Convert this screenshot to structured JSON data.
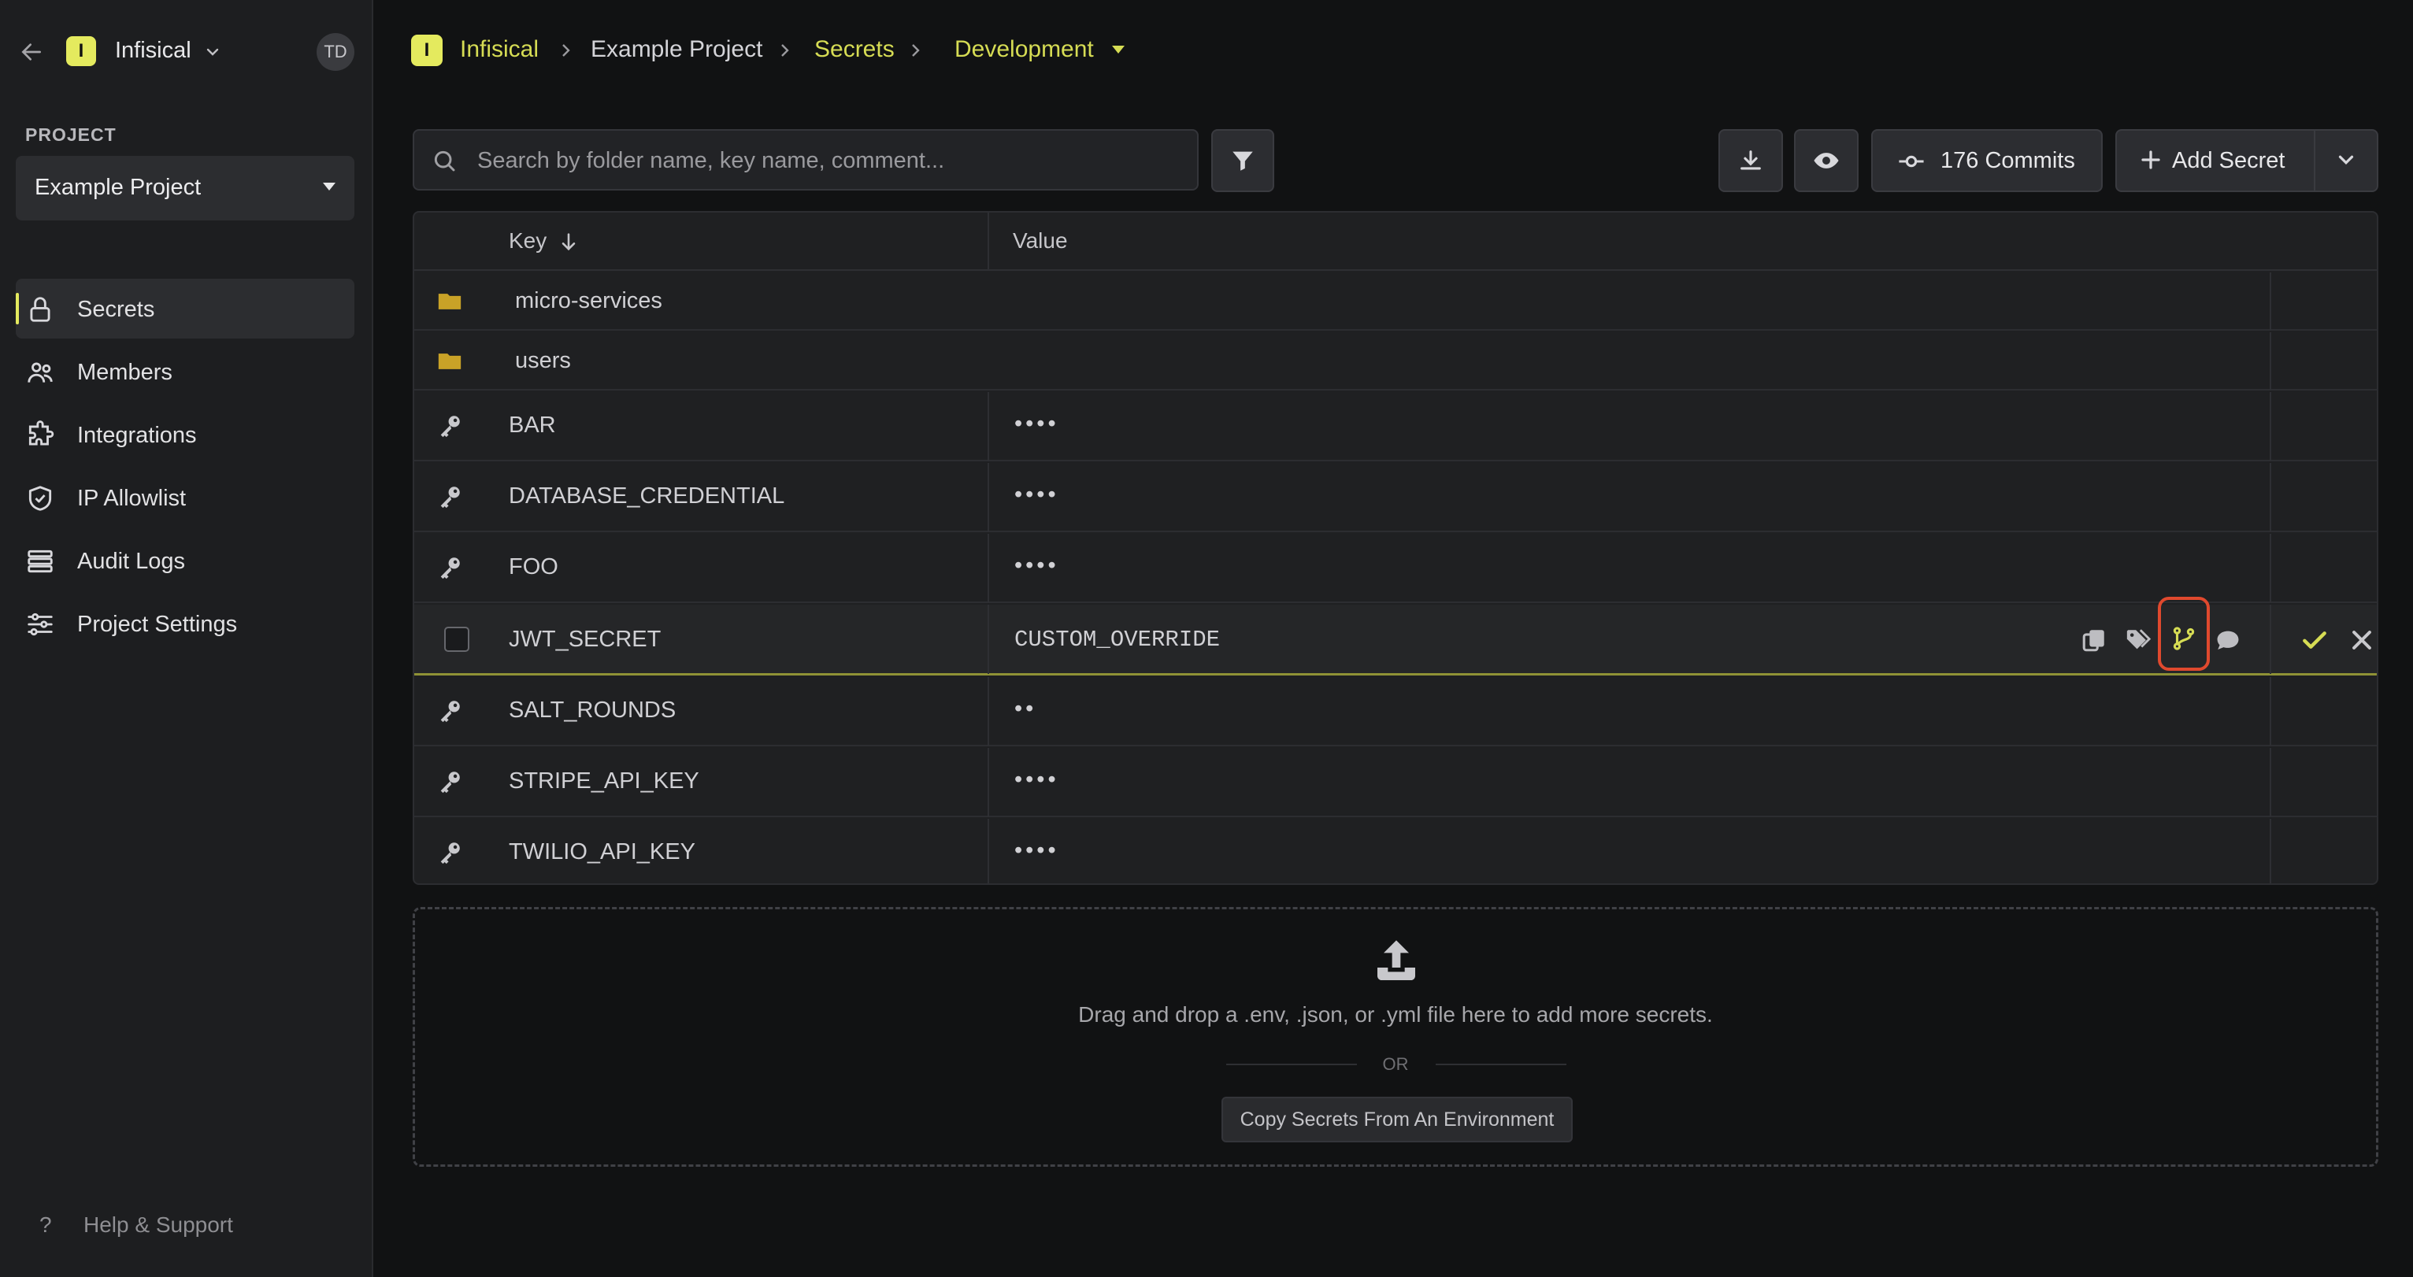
{
  "org": {
    "logo_letter": "I",
    "name": "Infisical",
    "avatar_initials": "TD"
  },
  "project": {
    "section_label": "PROJECT",
    "selected": "Example Project"
  },
  "nav": {
    "items": [
      {
        "label": "Secrets",
        "icon": "lock-icon",
        "active": true
      },
      {
        "label": "Members",
        "icon": "users-icon"
      },
      {
        "label": "Integrations",
        "icon": "puzzle-icon"
      },
      {
        "label": "IP Allowlist",
        "icon": "shield-icon"
      },
      {
        "label": "Audit Logs",
        "icon": "list-icon"
      },
      {
        "label": "Project Settings",
        "icon": "sliders-icon"
      }
    ],
    "help": "Help & Support"
  },
  "breadcrumb": {
    "logo_letter": "I",
    "org": "Infisical",
    "project": "Example Project",
    "section": "Secrets",
    "environment": "Development"
  },
  "toolbar": {
    "search_placeholder": "Search by folder name, key name, comment...",
    "commits_label": "176 Commits",
    "add_secret_label": "Add Secret"
  },
  "table": {
    "headers": {
      "key": "Key",
      "value": "Value"
    },
    "folders": [
      "micro-services",
      "users"
    ],
    "secrets": [
      {
        "key": "BAR",
        "value": "••••"
      },
      {
        "key": "DATABASE_CREDENTIAL",
        "value": "••••"
      },
      {
        "key": "FOO",
        "value": "••••"
      },
      {
        "key": "JWT_SECRET",
        "value": "CUSTOM_OVERRIDE",
        "editing": true
      },
      {
        "key": "SALT_ROUNDS",
        "value": "••"
      },
      {
        "key": "STRIPE_API_KEY",
        "value": "••••"
      },
      {
        "key": "TWILIO_API_KEY",
        "value": "••••"
      }
    ]
  },
  "dropzone": {
    "message": "Drag and drop a .env, .json, or .yml file here to add more secrets.",
    "or": "OR",
    "copy_button": "Copy Secrets From An Environment"
  },
  "colors": {
    "accent": "#e4ea5e",
    "highlight": "#e0492e",
    "folder": "#c9a227"
  }
}
